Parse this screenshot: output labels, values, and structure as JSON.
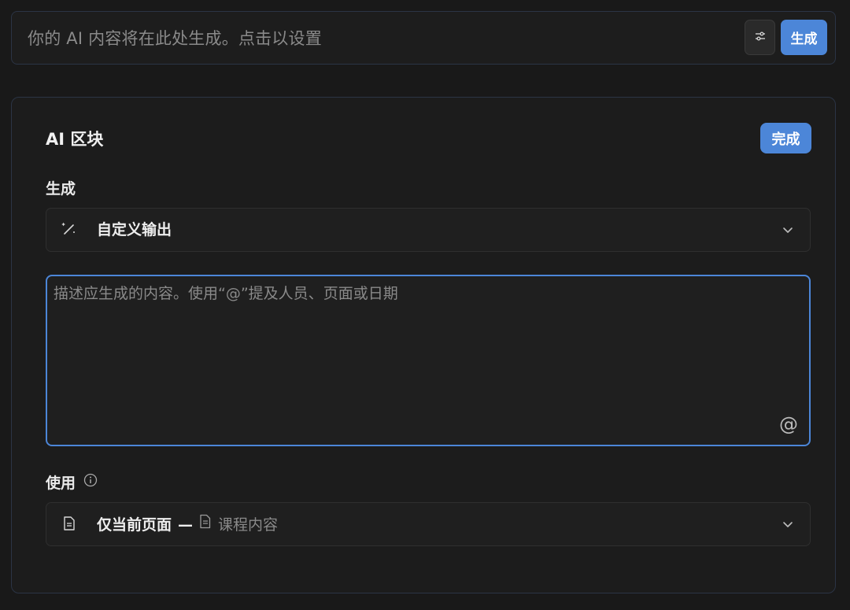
{
  "top_bar": {
    "placeholder": "你的 AI 内容将在此处生成。点击以设置",
    "generate_label": "生成",
    "settings_icon": "sliders-icon"
  },
  "panel": {
    "title": "AI 区块",
    "done_label": "完成",
    "generate_section": {
      "label": "生成",
      "selected_option": "自定义输出",
      "option_icon": "wand-icon"
    },
    "prompt": {
      "placeholder": "描述应生成的内容。使用“@”提及人员、页面或日期",
      "mention_symbol": "@"
    },
    "use_section": {
      "label": "使用",
      "scope_main": "仅当前页面",
      "scope_dash": "—",
      "scope_page": "课程内容"
    }
  },
  "colors": {
    "background": "#191919",
    "accent": "#4c86d8",
    "border": "#2b3445"
  }
}
